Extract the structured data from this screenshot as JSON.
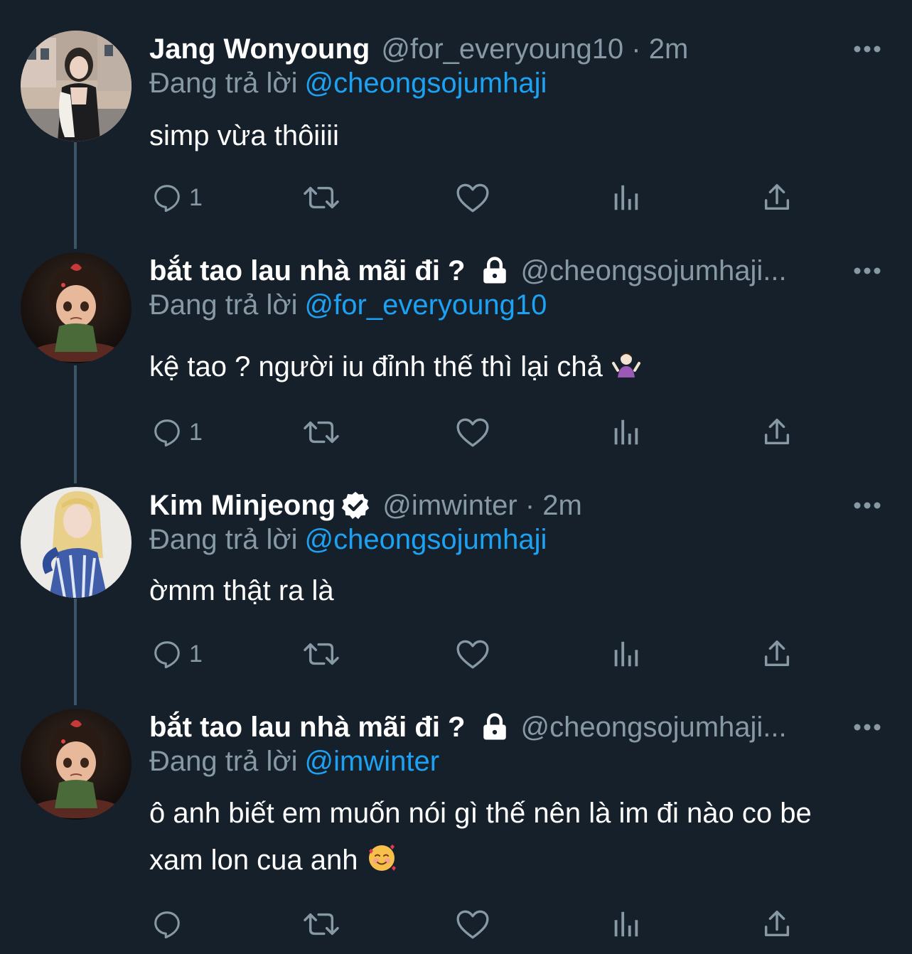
{
  "colors": {
    "background": "#15202b",
    "text_primary": "#ffffff",
    "text_secondary": "#8899a6",
    "link": "#1da1f2",
    "thread_line": "#3d5466"
  },
  "tweets": [
    {
      "name": "Jang Wonyoung",
      "handle": "@for_everyoung10 · 2m",
      "reply_label": "Đang trả lời",
      "reply_to": "@cheongsojumhaji",
      "text": "simp vừa thôiiii",
      "reply_count": "1",
      "avatar": "photo-avatar"
    },
    {
      "name": "bắt tao lau nhà mãi đi ?",
      "handle": "@cheongsojumhaji...",
      "reply_label": "Đang trả lời",
      "reply_to": "@for_everyoung10",
      "text": "kệ tao ? người iu đỉnh thế thì lại chả",
      "emoji": "person-shrugging-emoji",
      "reply_count": "1",
      "locked": true,
      "avatar": "cartoon-girl-avatar"
    },
    {
      "name": "Kim Minjeong",
      "handle": "@imwinter · 2m",
      "reply_label": "Đang trả lời",
      "reply_to": "@cheongsojumhaji",
      "text": "ờmm thật ra là",
      "reply_count": "1",
      "verified": true,
      "avatar": "blonde-photo-avatar"
    },
    {
      "name": "bắt tao lau nhà mãi đi ?",
      "handle": "@cheongsojumhaji...",
      "reply_label": "Đang trả lời",
      "reply_to": "@imwinter",
      "text_line1": "ô anh biết em muốn nói gì thế nên là im đi nào co be",
      "text_line2": "xam lon cua anh",
      "emoji": "smiling-face-with-hearts-emoji",
      "reply_count": "",
      "locked": true,
      "avatar": "cartoon-girl-avatar"
    }
  ]
}
